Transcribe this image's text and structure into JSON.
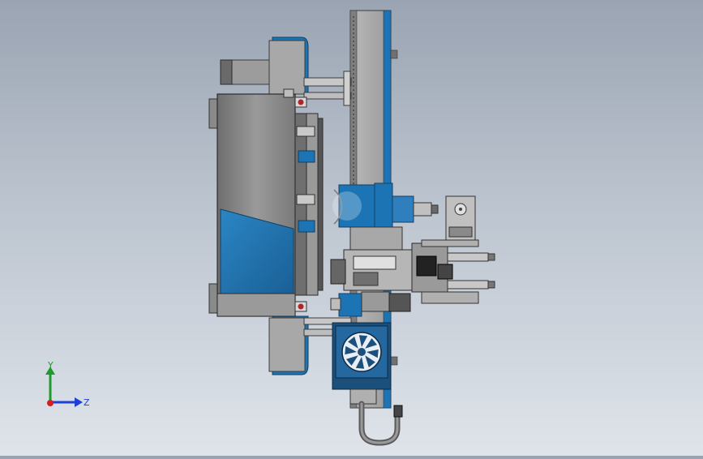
{
  "viewport": {
    "background_top": "#9aa4b2",
    "background_bottom": "#dfe4ea"
  },
  "triad": {
    "y_label": "Y",
    "z_label": "Z",
    "y_color": "#1f9a2e",
    "z_color": "#1f3fd6",
    "x_color": "#d21f1f"
  },
  "colors": {
    "accent_blue": "#1c74b4",
    "dark_blue": "#1b4f7c",
    "steel_gray": "#8c8c8c",
    "dark_gray": "#5a5a5a"
  }
}
